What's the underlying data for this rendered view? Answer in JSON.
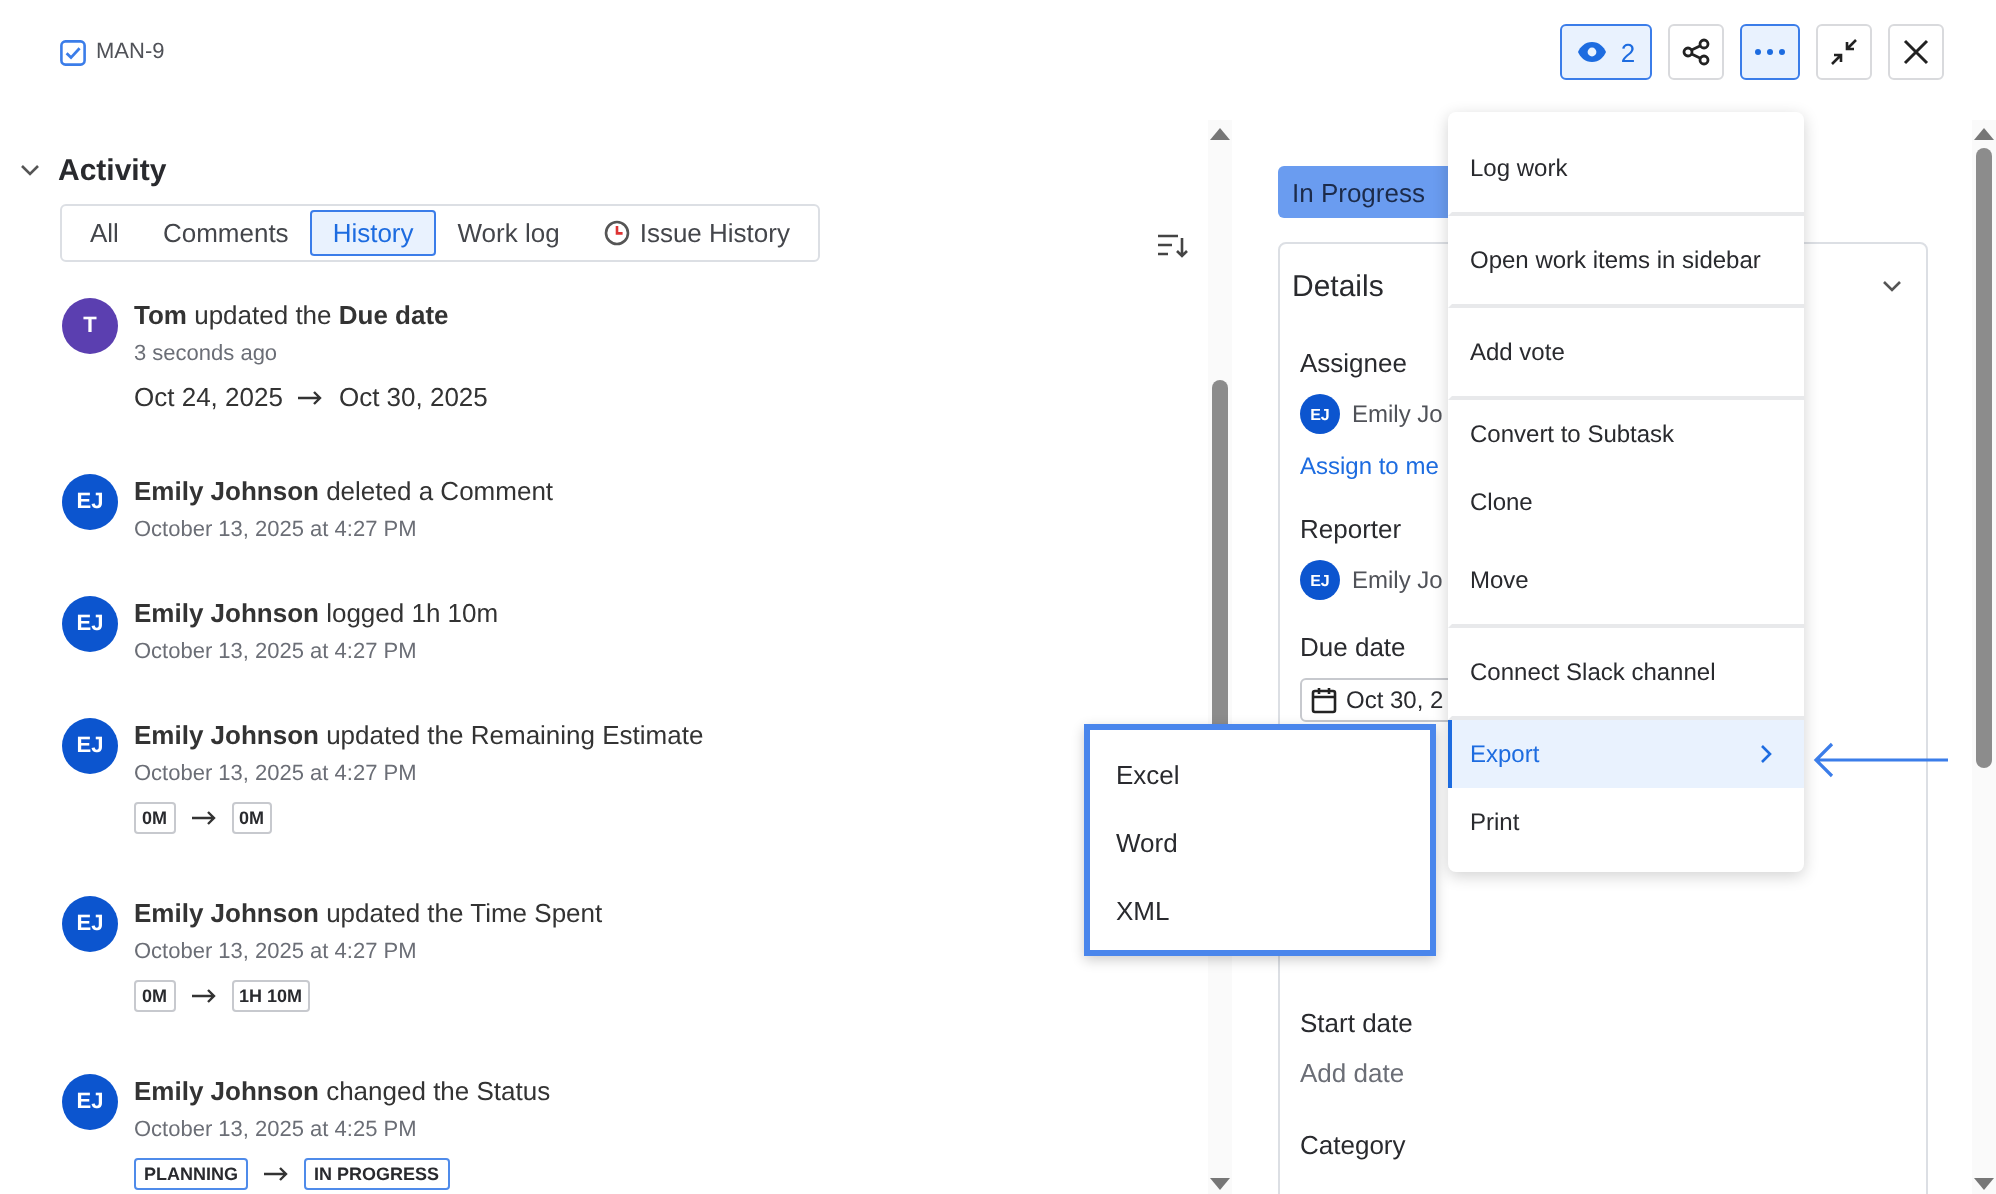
{
  "header": {
    "issue_key": "MAN-9",
    "issue_checked": true
  },
  "toolbar": [
    {
      "kind": "watch",
      "label": "2",
      "selected": true
    },
    {
      "kind": "share",
      "selected": false
    },
    {
      "kind": "more",
      "selected": true
    },
    {
      "kind": "collapse",
      "selected": false
    },
    {
      "kind": "close",
      "selected": false
    }
  ],
  "activity": {
    "title": "Activity",
    "expanded": true,
    "tabs": [
      {
        "label": "All",
        "selected": false
      },
      {
        "label": "Comments",
        "selected": false
      },
      {
        "label": "History",
        "selected": true
      },
      {
        "label": "Work log",
        "selected": false
      },
      {
        "label": "Issue History",
        "selected": false,
        "kind": "clock"
      }
    ],
    "entries": [
      {
        "avatar": "T",
        "color": "#5b3fb0",
        "text": "**Tom** updated the **Due date**",
        "time": "3 seconds ago",
        "change": {
          "kind": "text",
          "from": "Oct 24, 2025",
          "to": "Oct 30, 2025"
        }
      },
      {
        "avatar": "EJ",
        "color": "#0c55cf",
        "text": "**Emily Johnson** deleted a Comment",
        "time": "October 13, 2025 at 4:27 PM"
      },
      {
        "avatar": "EJ",
        "color": "#0c55cf",
        "text": "**Emily Johnson** logged 1h 10m",
        "time": "October 13, 2025 at 4:27 PM"
      },
      {
        "avatar": "EJ",
        "color": "#0c55cf",
        "text": "**Emily Johnson** updated the Remaining Estimate",
        "time": "October 13, 2025 at 4:27 PM",
        "change": {
          "kind": "tag",
          "from": "0M",
          "to": "0M"
        }
      },
      {
        "avatar": "EJ",
        "color": "#0c55cf",
        "text": "**Emily Johnson** updated the Time Spent",
        "time": "October 13, 2025 at 4:27 PM",
        "change": {
          "kind": "tag",
          "from": "0M",
          "to": "1H 10M"
        }
      },
      {
        "avatar": "EJ",
        "color": "#0c55cf",
        "text": "**Emily Johnson** changed the Status",
        "time": "October 13, 2025 at 4:25 PM",
        "change": {
          "kind": "status",
          "from": "PLANNING",
          "to": "IN PROGRESS"
        }
      }
    ]
  },
  "status_button": {
    "label": "In Progress"
  },
  "details": {
    "title": "Details",
    "expanded": true,
    "fields": [
      {
        "kind": "person",
        "label": "Assignee",
        "avatar": "EJ",
        "value": "Emily Jo",
        "link": "Assign to me"
      },
      {
        "kind": "person",
        "label": "Reporter",
        "avatar": "EJ",
        "value": "Emily Jo"
      },
      {
        "kind": "date",
        "label": "Due date",
        "value": "Oct 30, 2"
      },
      {
        "kind": "empty",
        "label": "Start date",
        "placeholder": "Add date"
      },
      {
        "kind": "label",
        "label": "Category"
      }
    ]
  },
  "menu": {
    "items": [
      {
        "label": "Log work",
        "divider_after": true,
        "selected": false
      },
      {
        "label": "Open work items in sidebar",
        "divider_after": true,
        "selected": false
      },
      {
        "label": "Add vote",
        "divider_after": true,
        "selected": false
      },
      {
        "label": "Convert to Subtask",
        "divider_after": false,
        "selected": false
      },
      {
        "label": "Clone",
        "divider_after": false,
        "selected": false
      },
      {
        "label": "Move",
        "divider_after": true,
        "selected": false
      },
      {
        "label": "Connect Slack channel",
        "divider_after": true,
        "selected": false
      },
      {
        "label": "Export",
        "divider_after": false,
        "selected": true,
        "submenu": true
      },
      {
        "label": "Print",
        "divider_after": false,
        "selected": false
      }
    ],
    "submenu": [
      "Excel",
      "Word",
      "XML"
    ]
  }
}
